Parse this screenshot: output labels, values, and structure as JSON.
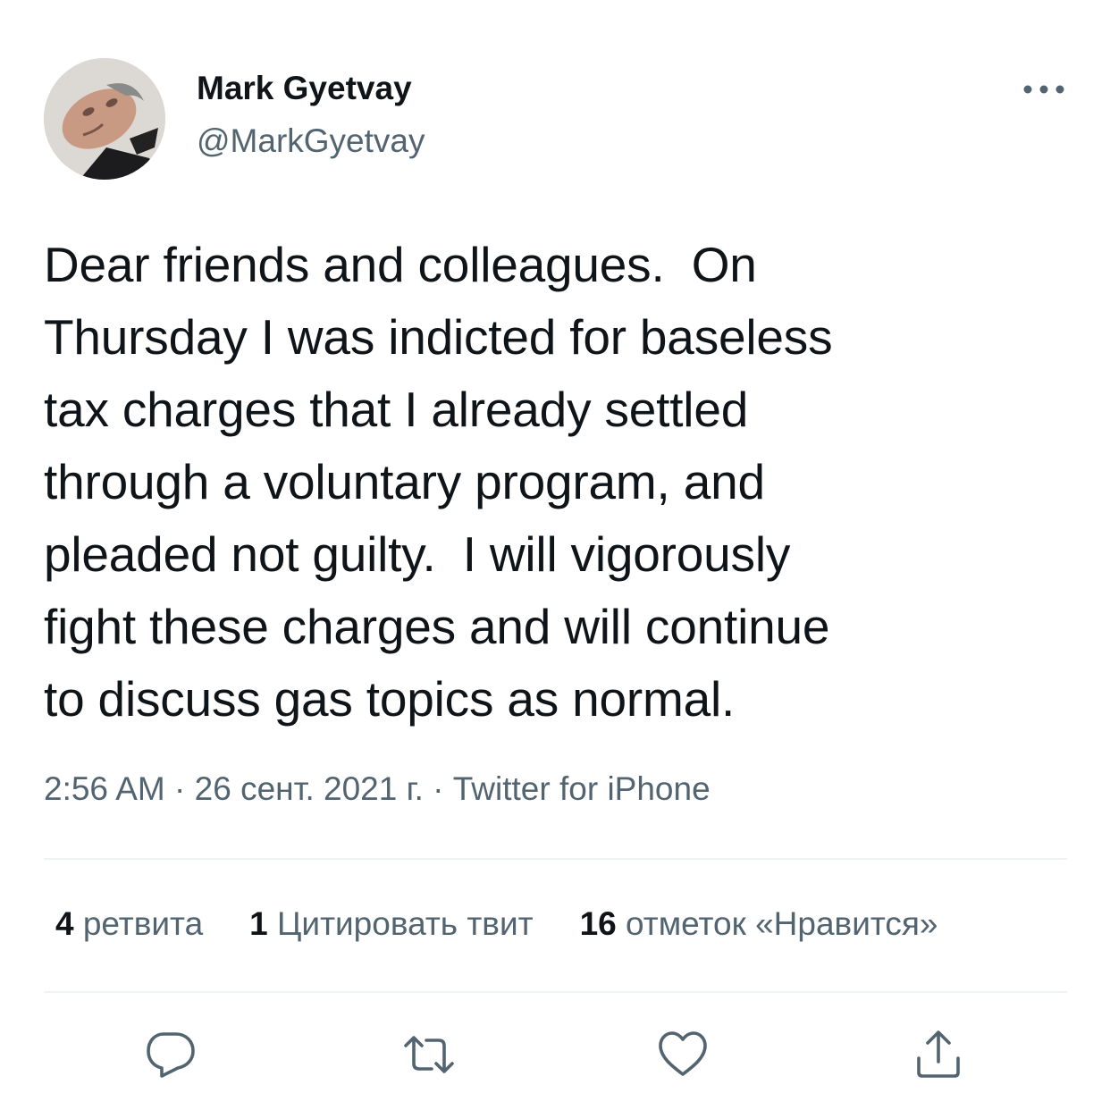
{
  "author": {
    "name": "Mark Gyetvay",
    "handle": "@MarkGyetvay",
    "avatar_icon": "profile-photo"
  },
  "tweet": {
    "text_lines": [
      "Dear friends and colleagues.  On",
      "Thursday I was indicted for baseless",
      "tax charges that I already settled",
      "through a voluntary program, and",
      "pleaded not guilty.  I will vigorously",
      "fight these charges and will continue",
      "to discuss gas topics as normal."
    ]
  },
  "meta": {
    "time": "2:56 AM",
    "separator": " · ",
    "date": "26 сент. 2021 г.",
    "source": "Twitter for iPhone"
  },
  "stats": {
    "retweets": {
      "count": "4",
      "label": " ретвита"
    },
    "quotes": {
      "count": "1",
      "label": " Цитировать твит"
    },
    "likes": {
      "count": "16",
      "label": " отметок «Нравится»"
    }
  },
  "actions": {
    "reply_icon": "reply-icon",
    "retweet_icon": "retweet-icon",
    "like_icon": "heart-icon",
    "share_icon": "share-icon",
    "more_icon": "more-icon"
  },
  "colors": {
    "text_primary": "#0f1419",
    "text_secondary": "#536471",
    "divider": "#eff3f4"
  }
}
